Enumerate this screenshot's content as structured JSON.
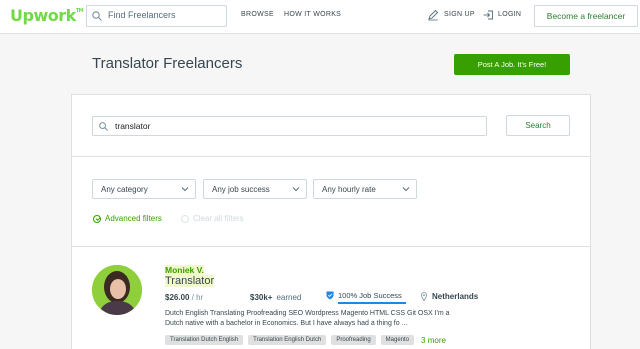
{
  "header": {
    "logo_text": "Upwork",
    "logo_tm": "TM",
    "search_placeholder": "Find Freelancers",
    "nav": {
      "browse": "BROWSE",
      "how_it_works": "HOW IT WORKS",
      "sign_up": "SIGN UP",
      "login": "LOGIN"
    },
    "become_button": "Become a freelancer"
  },
  "page": {
    "title": "Translator Freelancers",
    "post_job_button": "Post A Job. It's Free!"
  },
  "search": {
    "value": "translator",
    "button": "Search"
  },
  "filters": {
    "category": "Any category",
    "job_success": "Any job success",
    "hourly_rate": "Any hourly rate",
    "advanced": "Advanced filters",
    "clear": "Clear all filters"
  },
  "freelancer": {
    "name": "Moniek V.",
    "title": "Translator",
    "rate": "$26.00",
    "rate_unit": "/ hr",
    "earned_amount": "$30k+",
    "earned_label": "earned",
    "job_success": "100% Job Success",
    "job_success_value": 1.0,
    "location": "Netherlands",
    "description": "Dutch English Translating Proofreading SEO Wordpress Magento HTML CSS Git OSX I'm a Dutch native with a bachelor in Economics. But I have always had a thing fo ...",
    "tags": [
      "Translation Dutch English",
      "Translation English Dutch",
      "Proofreading",
      "Magento"
    ],
    "more": "3 more"
  },
  "colors": {
    "brand_green": "#6fda44",
    "action_green": "#37a000",
    "progress_blue": "#1e88e5"
  },
  "icons": [
    "search-icon",
    "pen-icon",
    "login-icon",
    "chevron-down-icon",
    "check-circle-icon",
    "shield-icon",
    "location-pin-icon"
  ]
}
